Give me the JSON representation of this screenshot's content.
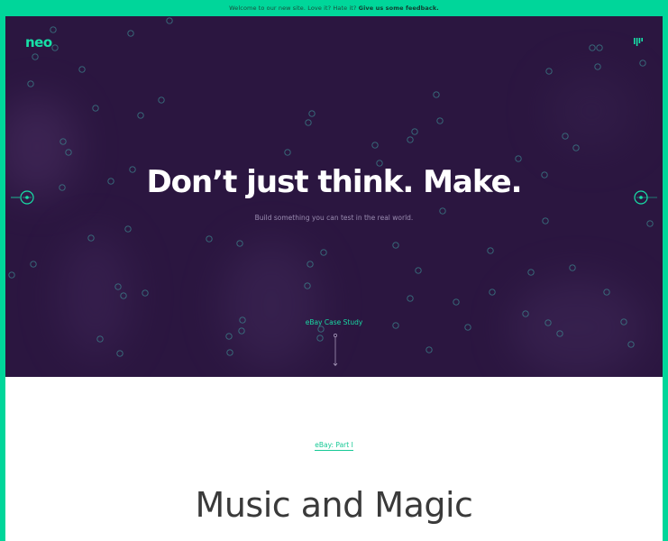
{
  "announcement": {
    "text": "Welcome to our new site. Love it? Hate it? ",
    "link_text": "Give us some feedback."
  },
  "brand": {
    "logo": "neo"
  },
  "hero": {
    "headline": "Don’t just think. Make.",
    "subheadline": "Build something you can test in the real world.",
    "case_study_link": "eBay Case Study"
  },
  "section": {
    "tag": "eBay: Part I",
    "title": "Music and Magic"
  },
  "colors": {
    "accent": "#00d69a",
    "hero_bg": "#2b1640",
    "title_text": "#3a3a3a"
  },
  "icons": {
    "menu": "menu-bars-icon",
    "prev": "arrow-left-circle-icon",
    "next": "arrow-right-circle-icon",
    "scroll": "scroll-down-line-icon"
  }
}
